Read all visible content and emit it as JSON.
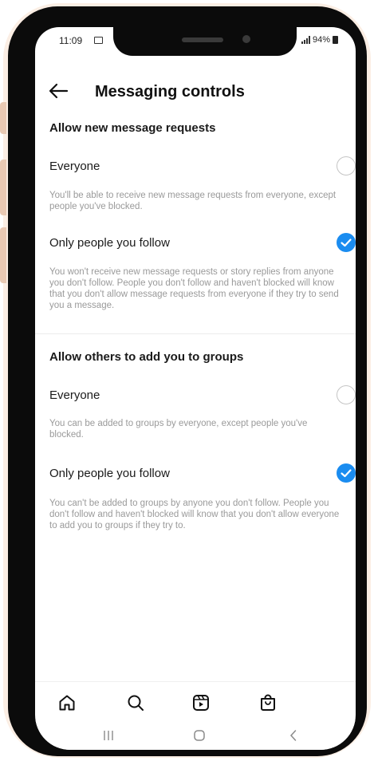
{
  "status_bar": {
    "time": "11:09",
    "battery": "94%"
  },
  "header": {
    "title": "Messaging controls"
  },
  "sections": [
    {
      "title": "Allow new message requests",
      "options": [
        {
          "label": "Everyone",
          "selected": false,
          "description": "You'll be able to receive new message requests from everyone, except people you've blocked."
        },
        {
          "label": "Only people you follow",
          "selected": true,
          "description": "You won't receive new message requests or story replies from anyone you don't follow. People you don't follow and haven't blocked will know that you don't allow message requests from everyone if they try to send you a message."
        }
      ]
    },
    {
      "title": "Allow others to add you to groups",
      "options": [
        {
          "label": "Everyone",
          "selected": false,
          "description": "You can be added to groups by everyone, except people you've blocked."
        },
        {
          "label": "Only people you follow",
          "selected": true,
          "description": "You can't be added to groups by anyone you don't follow. People you don't follow and haven't blocked will know that you don't allow everyone to add you to groups if they try to."
        }
      ]
    }
  ],
  "bottom_nav": [
    "home-icon",
    "search-icon",
    "reels-icon",
    "shop-icon"
  ],
  "system_nav": [
    "recents-icon",
    "home-button-icon",
    "back-icon"
  ],
  "colors": {
    "accent": "#1a8cf0",
    "text": "#1a1a1a",
    "muted": "#9a9a9a"
  }
}
